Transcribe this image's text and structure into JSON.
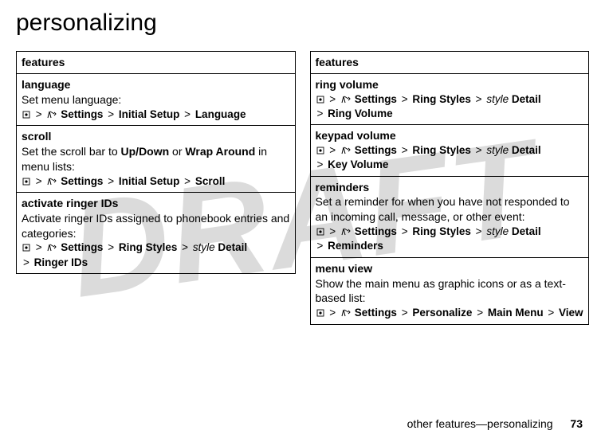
{
  "watermark": "DRAFT",
  "title": "personalizing",
  "left": {
    "header": "features",
    "rows": [
      {
        "subhead": "language",
        "desc": "Set menu language:",
        "crumb": [
          "Settings",
          "Initial Setup",
          "Language"
        ]
      },
      {
        "subhead": "scroll",
        "desc_pre": "Set the scroll bar to ",
        "bold_a": "Up/Down",
        "mid": " or ",
        "bold_b": "Wrap Around",
        "desc_post": " in menu lists:",
        "crumb": [
          "Settings",
          "Initial Setup",
          "Scroll"
        ]
      },
      {
        "subhead": "activate ringer IDs",
        "desc": "Activate ringer IDs assigned to phonebook entries and categories:",
        "crumb": [
          "Settings",
          "Ring Styles",
          "style",
          "Detail",
          "Ringer IDs"
        ]
      }
    ]
  },
  "right": {
    "header": "features",
    "rows": [
      {
        "subhead": "ring volume",
        "crumb": [
          "Settings",
          "Ring Styles",
          "style",
          "Detail",
          "Ring Volume"
        ]
      },
      {
        "subhead": "keypad volume",
        "crumb": [
          "Settings",
          "Ring Styles",
          "style",
          "Detail",
          "Key Volume"
        ]
      },
      {
        "subhead": "reminders",
        "desc": "Set a reminder for when you have not responded to an incoming call, message, or other event:",
        "crumb": [
          "Settings",
          "Ring Styles",
          "style",
          "Detail",
          "Reminders"
        ]
      },
      {
        "subhead": "menu view",
        "desc": "Show the main menu as graphic icons or as a text-based list:",
        "crumb": [
          "Settings",
          "Personalize",
          "Main Menu",
          "View"
        ]
      }
    ]
  },
  "footer": {
    "text": "other features—personalizing",
    "page": "73"
  }
}
